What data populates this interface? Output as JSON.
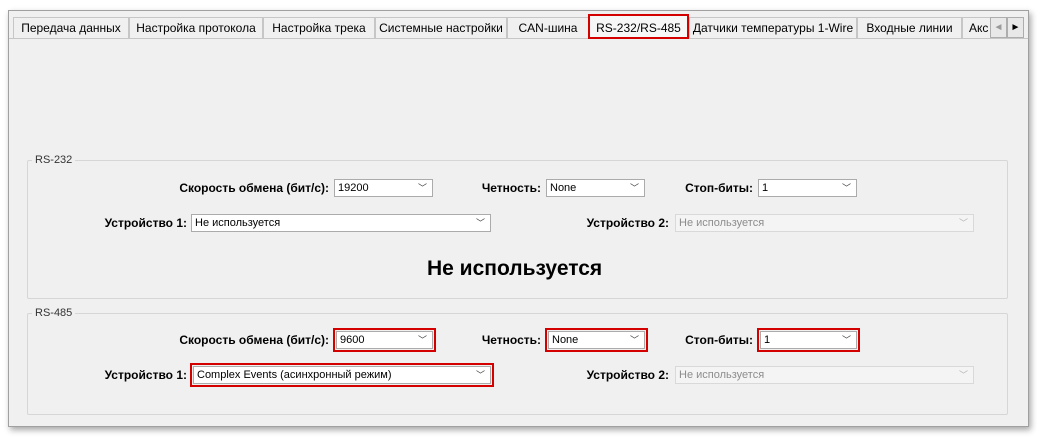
{
  "tabs": [
    {
      "label": "Передача данных",
      "active": false
    },
    {
      "label": "Настройка протокола",
      "active": false
    },
    {
      "label": "Настройка трека",
      "active": false
    },
    {
      "label": "Системные настройки",
      "active": false
    },
    {
      "label": "CAN-шина",
      "active": false
    },
    {
      "label": "RS-232/RS-485",
      "active": true
    },
    {
      "label": "Датчики температуры 1-Wire",
      "active": false
    },
    {
      "label": "Входные линии",
      "active": false
    },
    {
      "label": "Акс",
      "active": false
    }
  ],
  "tab_scroll": {
    "left_icon": "◄",
    "right_icon": "►"
  },
  "rs232": {
    "title": "RS-232",
    "baud_label": "Скорость обмена (бит/с):",
    "baud_value": "19200",
    "parity_label": "Четность:",
    "parity_value": "None",
    "stopbits_label": "Стоп-биты:",
    "stopbits_value": "1",
    "device1_label": "Устройство 1:",
    "device1_value": "Не используется",
    "device2_label": "Устройство 2:",
    "device2_value": "Не используется",
    "status_text": "Не используется"
  },
  "rs485": {
    "title": "RS-485",
    "baud_label": "Скорость обмена (бит/с):",
    "baud_value": "9600",
    "parity_label": "Четность:",
    "parity_value": "None",
    "stopbits_label": "Стоп-биты:",
    "stopbits_value": "1",
    "device1_label": "Устройство 1:",
    "device1_value": "Complex Events (асинхронный режим)",
    "device2_label": "Устройство 2:",
    "device2_value": "Не используется"
  },
  "chevron": "﹀",
  "colors": {
    "highlight": "#d40000",
    "panel": "#f0f0f0"
  }
}
